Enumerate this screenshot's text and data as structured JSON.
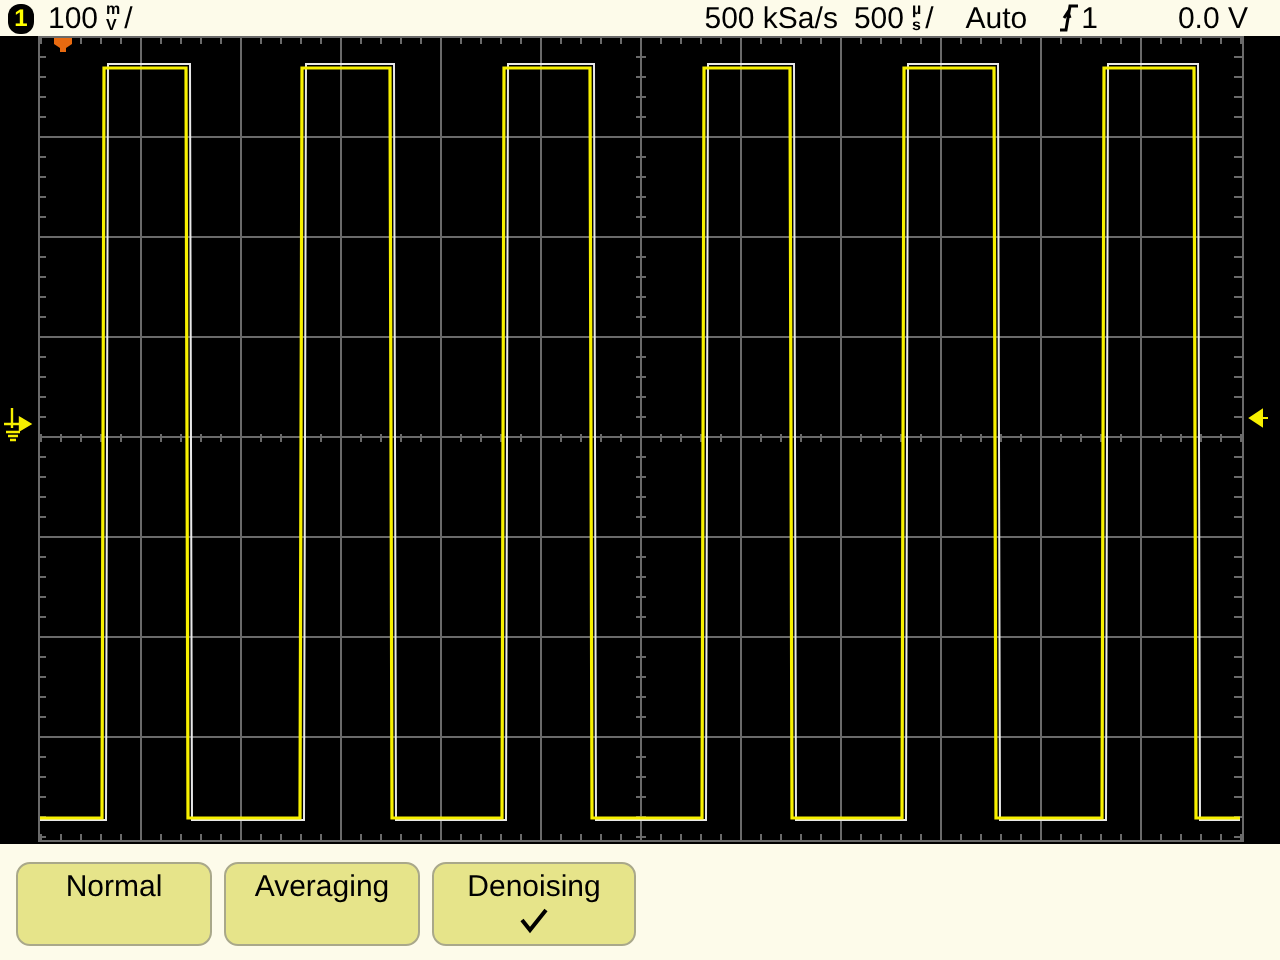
{
  "status_bar": {
    "channel": "1",
    "vertical_scale": "100",
    "vertical_unit_top": "m",
    "vertical_unit_bottom": "V",
    "vertical_slash": "/",
    "sample_rate": "500 kSa/s",
    "time_scale": "500",
    "time_unit_top": "µ",
    "time_unit_bottom": "s",
    "time_slash": "/",
    "trigger_mode": "Auto",
    "trigger_source": "1",
    "trigger_level": "0.0 V"
  },
  "softkeys": [
    {
      "label": "Normal",
      "selected": false
    },
    {
      "label": "Averaging",
      "selected": false
    },
    {
      "label": "Denoising",
      "selected": true
    }
  ]
}
